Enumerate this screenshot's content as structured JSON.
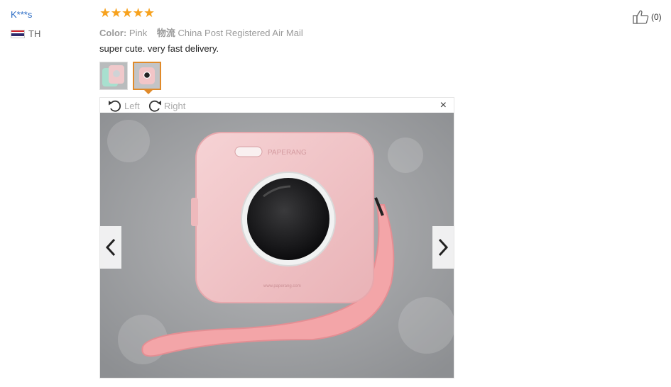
{
  "review": {
    "user_name": "K***s",
    "country_code": "TH",
    "rating_stars": 5,
    "color_label": "Color:",
    "color_value": "Pink",
    "shipping_label": "物流",
    "shipping_value": "China Post Registered Air Mail",
    "text": "super cute. very fast delivery.",
    "helpful_count": "(0)"
  },
  "viewer": {
    "rotate_left_label": "Left",
    "rotate_right_label": "Right",
    "close_symbol": "×",
    "prev_icon": "chevron-left-icon",
    "next_icon": "chevron-right-icon",
    "photo_watermark": "PAPERANG"
  },
  "colors": {
    "username": "#2d6dc5",
    "star": "#f7a21e",
    "selected_thumb_border": "#e08a2a",
    "camera_pink": "#f2c5c7"
  }
}
